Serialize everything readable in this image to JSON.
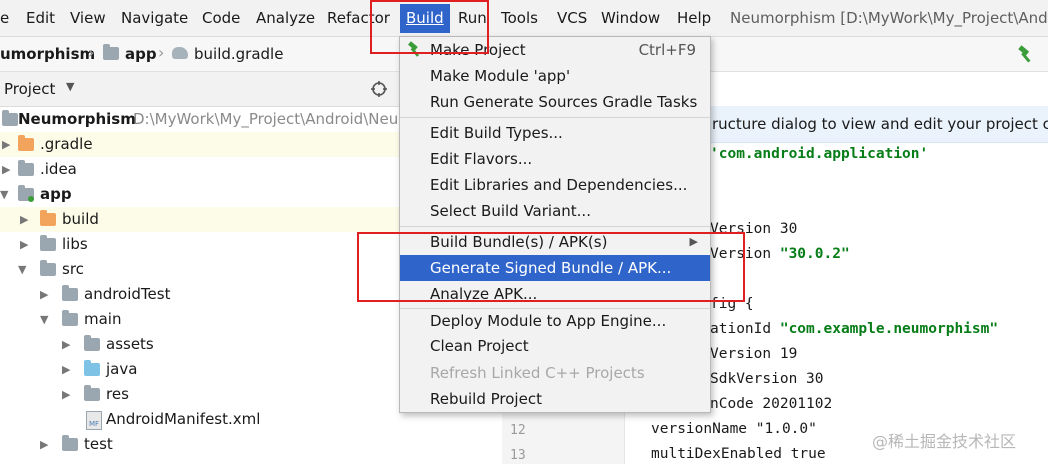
{
  "menubar": {
    "items": [
      {
        "label": "e"
      },
      {
        "label": "Edit"
      },
      {
        "label": "View"
      },
      {
        "label": "Navigate"
      },
      {
        "label": "Code"
      },
      {
        "label": "Analyze"
      },
      {
        "label": "Refactor"
      },
      {
        "label": "Build"
      },
      {
        "label": "Run"
      },
      {
        "label": "Tools"
      },
      {
        "label": "VCS"
      },
      {
        "label": "Window"
      },
      {
        "label": "Help"
      }
    ],
    "window_title": "Neumorphism [D:\\MyWork\\My_Project\\And"
  },
  "navbar": {
    "crumbs": [
      "umorphism",
      "app",
      "build.gradle"
    ]
  },
  "project_panel": {
    "title": "Project",
    "root_name": "Neumorphism",
    "root_path": "D:\\MyWork\\My_Project\\Android\\Neu",
    "tree": [
      {
        "label": ".gradle"
      },
      {
        "label": ".idea"
      },
      {
        "label": "app"
      },
      {
        "label": "build"
      },
      {
        "label": "libs"
      },
      {
        "label": "src"
      },
      {
        "label": "androidTest"
      },
      {
        "label": "main"
      },
      {
        "label": "assets"
      },
      {
        "label": "java"
      },
      {
        "label": "res"
      },
      {
        "label": "AndroidManifest.xml"
      },
      {
        "label": "test"
      }
    ]
  },
  "editor": {
    "banner": "ructure dialog to view and edit your project cor",
    "lines": [
      {
        "no": "12",
        "text": "versionName \"1.0.0\""
      },
      {
        "no": "13",
        "text": "multiDexEnabled true"
      }
    ],
    "fragments": {
      "plugin_str": "'com.android.application'",
      "compile_sdk": "Version 30",
      "build_tools_kw": "Version ",
      "build_tools_val": "\"30.0.2\"",
      "default_config": "fig {",
      "app_id_kw": "ationId ",
      "app_id_val": "\"com.example.neumorphism\"",
      "min_sdk": "Version 19",
      "target_sdk": "SdkVersion 30",
      "version_code": "nCode 20201102"
    }
  },
  "build_menu": {
    "items": [
      {
        "label": "Make Project",
        "shortcut": "Ctrl+F9"
      },
      {
        "label": "Make Module 'app'"
      },
      {
        "label": "Run Generate Sources Gradle Tasks"
      },
      {
        "label": "Edit Build Types..."
      },
      {
        "label": "Edit Flavors..."
      },
      {
        "label": "Edit Libraries and Dependencies..."
      },
      {
        "label": "Select Build Variant..."
      },
      {
        "label": "Build Bundle(s) / APK(s)"
      },
      {
        "label": "Generate Signed Bundle / APK..."
      },
      {
        "label": "Analyze APK..."
      },
      {
        "label": "Deploy Module to App Engine..."
      },
      {
        "label": "Clean Project"
      },
      {
        "label": "Refresh Linked C++ Projects"
      },
      {
        "label": "Rebuild Project"
      }
    ]
  },
  "watermark": "@稀土掘金技术社区",
  "colors": {
    "selection": "#2f65ca",
    "annotation_red": "#e02020",
    "string_green": "#067d17",
    "number_blue": "#1750eb"
  }
}
